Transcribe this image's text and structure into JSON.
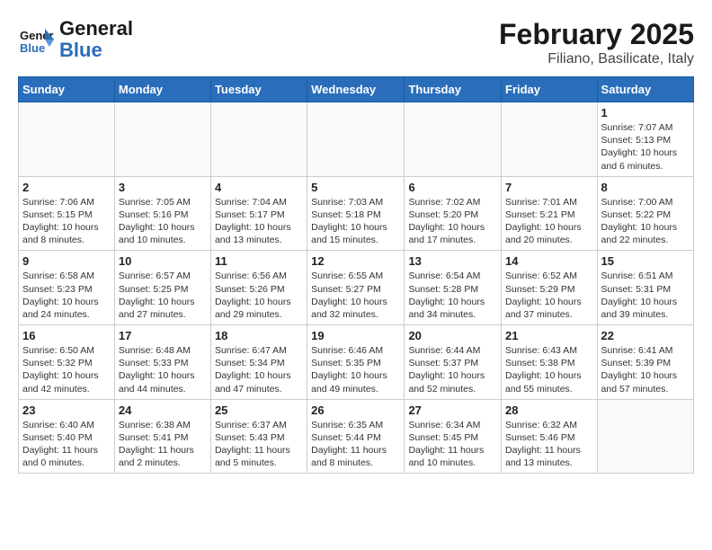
{
  "logo": {
    "general": "General",
    "blue": "Blue"
  },
  "title": "February 2025",
  "subtitle": "Filiano, Basilicate, Italy",
  "weekdays": [
    "Sunday",
    "Monday",
    "Tuesday",
    "Wednesday",
    "Thursday",
    "Friday",
    "Saturday"
  ],
  "weeks": [
    [
      {
        "day": "",
        "info": ""
      },
      {
        "day": "",
        "info": ""
      },
      {
        "day": "",
        "info": ""
      },
      {
        "day": "",
        "info": ""
      },
      {
        "day": "",
        "info": ""
      },
      {
        "day": "",
        "info": ""
      },
      {
        "day": "1",
        "info": "Sunrise: 7:07 AM\nSunset: 5:13 PM\nDaylight: 10 hours\nand 6 minutes."
      }
    ],
    [
      {
        "day": "2",
        "info": "Sunrise: 7:06 AM\nSunset: 5:15 PM\nDaylight: 10 hours\nand 8 minutes."
      },
      {
        "day": "3",
        "info": "Sunrise: 7:05 AM\nSunset: 5:16 PM\nDaylight: 10 hours\nand 10 minutes."
      },
      {
        "day": "4",
        "info": "Sunrise: 7:04 AM\nSunset: 5:17 PM\nDaylight: 10 hours\nand 13 minutes."
      },
      {
        "day": "5",
        "info": "Sunrise: 7:03 AM\nSunset: 5:18 PM\nDaylight: 10 hours\nand 15 minutes."
      },
      {
        "day": "6",
        "info": "Sunrise: 7:02 AM\nSunset: 5:20 PM\nDaylight: 10 hours\nand 17 minutes."
      },
      {
        "day": "7",
        "info": "Sunrise: 7:01 AM\nSunset: 5:21 PM\nDaylight: 10 hours\nand 20 minutes."
      },
      {
        "day": "8",
        "info": "Sunrise: 7:00 AM\nSunset: 5:22 PM\nDaylight: 10 hours\nand 22 minutes."
      }
    ],
    [
      {
        "day": "9",
        "info": "Sunrise: 6:58 AM\nSunset: 5:23 PM\nDaylight: 10 hours\nand 24 minutes."
      },
      {
        "day": "10",
        "info": "Sunrise: 6:57 AM\nSunset: 5:25 PM\nDaylight: 10 hours\nand 27 minutes."
      },
      {
        "day": "11",
        "info": "Sunrise: 6:56 AM\nSunset: 5:26 PM\nDaylight: 10 hours\nand 29 minutes."
      },
      {
        "day": "12",
        "info": "Sunrise: 6:55 AM\nSunset: 5:27 PM\nDaylight: 10 hours\nand 32 minutes."
      },
      {
        "day": "13",
        "info": "Sunrise: 6:54 AM\nSunset: 5:28 PM\nDaylight: 10 hours\nand 34 minutes."
      },
      {
        "day": "14",
        "info": "Sunrise: 6:52 AM\nSunset: 5:29 PM\nDaylight: 10 hours\nand 37 minutes."
      },
      {
        "day": "15",
        "info": "Sunrise: 6:51 AM\nSunset: 5:31 PM\nDaylight: 10 hours\nand 39 minutes."
      }
    ],
    [
      {
        "day": "16",
        "info": "Sunrise: 6:50 AM\nSunset: 5:32 PM\nDaylight: 10 hours\nand 42 minutes."
      },
      {
        "day": "17",
        "info": "Sunrise: 6:48 AM\nSunset: 5:33 PM\nDaylight: 10 hours\nand 44 minutes."
      },
      {
        "day": "18",
        "info": "Sunrise: 6:47 AM\nSunset: 5:34 PM\nDaylight: 10 hours\nand 47 minutes."
      },
      {
        "day": "19",
        "info": "Sunrise: 6:46 AM\nSunset: 5:35 PM\nDaylight: 10 hours\nand 49 minutes."
      },
      {
        "day": "20",
        "info": "Sunrise: 6:44 AM\nSunset: 5:37 PM\nDaylight: 10 hours\nand 52 minutes."
      },
      {
        "day": "21",
        "info": "Sunrise: 6:43 AM\nSunset: 5:38 PM\nDaylight: 10 hours\nand 55 minutes."
      },
      {
        "day": "22",
        "info": "Sunrise: 6:41 AM\nSunset: 5:39 PM\nDaylight: 10 hours\nand 57 minutes."
      }
    ],
    [
      {
        "day": "23",
        "info": "Sunrise: 6:40 AM\nSunset: 5:40 PM\nDaylight: 11 hours\nand 0 minutes."
      },
      {
        "day": "24",
        "info": "Sunrise: 6:38 AM\nSunset: 5:41 PM\nDaylight: 11 hours\nand 2 minutes."
      },
      {
        "day": "25",
        "info": "Sunrise: 6:37 AM\nSunset: 5:43 PM\nDaylight: 11 hours\nand 5 minutes."
      },
      {
        "day": "26",
        "info": "Sunrise: 6:35 AM\nSunset: 5:44 PM\nDaylight: 11 hours\nand 8 minutes."
      },
      {
        "day": "27",
        "info": "Sunrise: 6:34 AM\nSunset: 5:45 PM\nDaylight: 11 hours\nand 10 minutes."
      },
      {
        "day": "28",
        "info": "Sunrise: 6:32 AM\nSunset: 5:46 PM\nDaylight: 11 hours\nand 13 minutes."
      },
      {
        "day": "",
        "info": ""
      }
    ]
  ]
}
